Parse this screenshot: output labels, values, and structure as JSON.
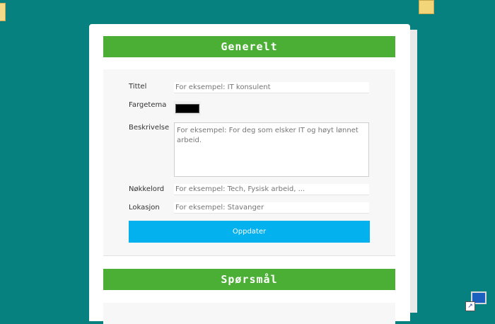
{
  "sections": {
    "general_title": "Generelt",
    "questions_title": "Spørsmål"
  },
  "form": {
    "title": {
      "label": "Tittel",
      "placeholder": "For eksempel: IT konsulent"
    },
    "color_theme": {
      "label": "Fargetema",
      "value": "#000000"
    },
    "description": {
      "label": "Beskrivelse",
      "placeholder": "For eksempel: For deg som elsker IT og høyt lønnet arbeid."
    },
    "keywords": {
      "label": "Nøkkelord",
      "placeholder": "For eksempel: Tech, Fysisk arbeid, ..."
    },
    "location": {
      "label": "Lokasjon",
      "placeholder": "For eksempel: Stavanger"
    },
    "submit_label": "Oppdater"
  },
  "desktop": {
    "icons": [
      "folder-icon",
      "folder-icon",
      "computer-shortcut-icon"
    ]
  }
}
